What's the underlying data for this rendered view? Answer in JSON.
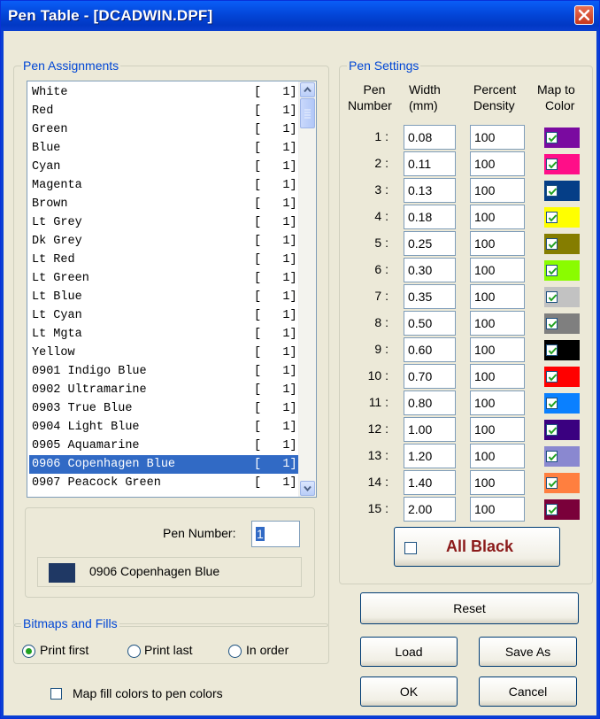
{
  "window": {
    "title": "Pen Table - [DCADWIN.DPF]"
  },
  "pen_assignments": {
    "legend": "Pen Assignments",
    "items": [
      {
        "name": "White",
        "pen": "[   1]"
      },
      {
        "name": "Red",
        "pen": "[   1]"
      },
      {
        "name": "Green",
        "pen": "[   1]"
      },
      {
        "name": "Blue",
        "pen": "[   1]"
      },
      {
        "name": "Cyan",
        "pen": "[   1]"
      },
      {
        "name": "Magenta",
        "pen": "[   1]"
      },
      {
        "name": "Brown",
        "pen": "[   1]"
      },
      {
        "name": "Lt Grey",
        "pen": "[   1]"
      },
      {
        "name": "Dk Grey",
        "pen": "[   1]"
      },
      {
        "name": "Lt Red",
        "pen": "[   1]"
      },
      {
        "name": "Lt Green",
        "pen": "[   1]"
      },
      {
        "name": "Lt Blue",
        "pen": "[   1]"
      },
      {
        "name": "Lt Cyan",
        "pen": "[   1]"
      },
      {
        "name": "Lt Mgta",
        "pen": "[   1]"
      },
      {
        "name": "Yellow",
        "pen": "[   1]"
      },
      {
        "name": "0901 Indigo Blue",
        "pen": "[   1]"
      },
      {
        "name": "0902 Ultramarine",
        "pen": "[   1]"
      },
      {
        "name": "0903 True Blue",
        "pen": "[   1]"
      },
      {
        "name": "0904 Light Blue",
        "pen": "[   1]"
      },
      {
        "name": "0905 Aquamarine",
        "pen": "[   1]"
      },
      {
        "name": "0906 Copenhagen Blue",
        "pen": "[   1]",
        "selected": true
      },
      {
        "name": "0907 Peacock Green",
        "pen": "[   1]"
      }
    ],
    "pen_number_label": "Pen Number:",
    "pen_number_value": "1",
    "selected_color_name": "0906 Copenhagen Blue",
    "selected_color": "#1f3864"
  },
  "pen_settings": {
    "legend": "Pen Settings",
    "headers": {
      "pen_line1": "Pen",
      "pen_line2": "Number",
      "width_line1": "Width",
      "width_line2": "(mm)",
      "percent_line1": "Percent",
      "percent_line2": "Density",
      "map_line1": "Map to",
      "map_line2": "Color"
    },
    "rows": [
      {
        "num": "1 :",
        "width": "0.08",
        "density": "100",
        "mapped": true,
        "color": "#7a0aa0"
      },
      {
        "num": "2 :",
        "width": "0.11",
        "density": "100",
        "mapped": true,
        "color": "#ff0e88"
      },
      {
        "num": "3 :",
        "width": "0.13",
        "density": "100",
        "mapped": true,
        "color": "#053e87"
      },
      {
        "num": "4 :",
        "width": "0.18",
        "density": "100",
        "mapped": true,
        "color": "#ffff00"
      },
      {
        "num": "5 :",
        "width": "0.25",
        "density": "100",
        "mapped": true,
        "color": "#857d00"
      },
      {
        "num": "6 :",
        "width": "0.30",
        "density": "100",
        "mapped": true,
        "color": "#8afc00"
      },
      {
        "num": "7 :",
        "width": "0.35",
        "density": "100",
        "mapped": true,
        "color": "#c2c2c2"
      },
      {
        "num": "8 :",
        "width": "0.50",
        "density": "100",
        "mapped": true,
        "color": "#7f7f7f"
      },
      {
        "num": "9 :",
        "width": "0.60",
        "density": "100",
        "mapped": true,
        "color": "#000000"
      },
      {
        "num": "10 :",
        "width": "0.70",
        "density": "100",
        "mapped": true,
        "color": "#ff0000"
      },
      {
        "num": "11 :",
        "width": "0.80",
        "density": "100",
        "mapped": true,
        "color": "#0a80ff"
      },
      {
        "num": "12 :",
        "width": "1.00",
        "density": "100",
        "mapped": true,
        "color": "#3a0080"
      },
      {
        "num": "13 :",
        "width": "1.20",
        "density": "100",
        "mapped": true,
        "color": "#8a88d0"
      },
      {
        "num": "14 :",
        "width": "1.40",
        "density": "100",
        "mapped": true,
        "color": "#ff7f3f"
      },
      {
        "num": "15 :",
        "width": "2.00",
        "density": "100",
        "mapped": true,
        "color": "#7a003a"
      }
    ],
    "all_black_label": "All Black",
    "all_black_checked": false
  },
  "bitmaps": {
    "legend": "Bitmaps and Fills",
    "options": [
      "Print first",
      "Print last",
      "In order"
    ],
    "selected": "Print first",
    "map_fill_label": "Map fill colors to pen colors",
    "map_fill_checked": false
  },
  "buttons": {
    "reset": "Reset",
    "load": "Load",
    "save_as": "Save As",
    "ok": "OK",
    "cancel": "Cancel"
  }
}
